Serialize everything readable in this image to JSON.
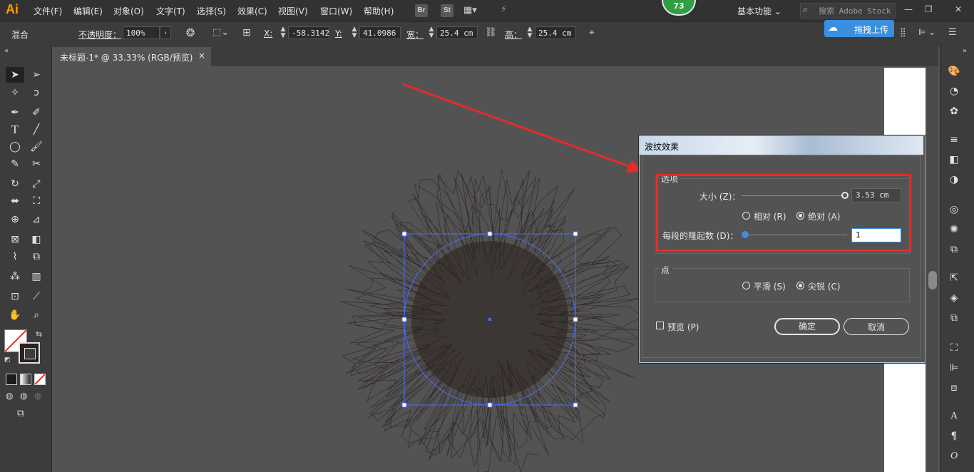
{
  "app": {
    "logo": "Ai",
    "menus": [
      "文件(F)",
      "编辑(E)",
      "对象(O)",
      "文字(T)",
      "选择(S)",
      "效果(C)",
      "视图(V)",
      "窗口(W)",
      "帮助(H)"
    ],
    "menubar_icons": [
      "Br",
      "St"
    ],
    "workspace": "基本功能",
    "search_placeholder": "搜索 Adobe Stock",
    "notification_count": "73"
  },
  "control_bar": {
    "mode_label": "混合",
    "opacity_label": "不透明度：",
    "opacity_value": "100%",
    "x_label": "X:",
    "x_value": "-58.3142",
    "y_label": "Y:",
    "y_value": "41.0986 c",
    "w_label": "宽：",
    "w_value": "25.4 cm",
    "h_label": "高：",
    "h_value": "25.4 cm",
    "upload_label": "拖拽上传"
  },
  "document": {
    "tab_title": "未标题-1* @ 33.33% (RGB/预览)",
    "close_glyph": "×"
  },
  "dialog": {
    "title": "波纹效果",
    "options_group": "选项",
    "size_label": "大小 (Z)：",
    "size_value": "3.53 cm",
    "size_slider_fraction": 1.0,
    "relative_label": "相对 (R)",
    "absolute_label": "绝对 (A)",
    "size_mode": "absolute",
    "ridges_label": "每段的隆起数 (D)：",
    "ridges_value": "1",
    "ridges_slider_fraction": 0.0,
    "points_group": "点",
    "smooth_label": "平滑 (S)",
    "corner_label": "尖锐 (C)",
    "points_mode": "corner",
    "preview_label": "预览 (P)",
    "preview_checked": false,
    "ok_label": "确定",
    "cancel_label": "取消"
  },
  "colors": {
    "accent_blue": "#3b8fe0",
    "highlight_red": "#e52b2b",
    "selection_blue": "#4a6cff",
    "scribble": "#2a201d"
  }
}
